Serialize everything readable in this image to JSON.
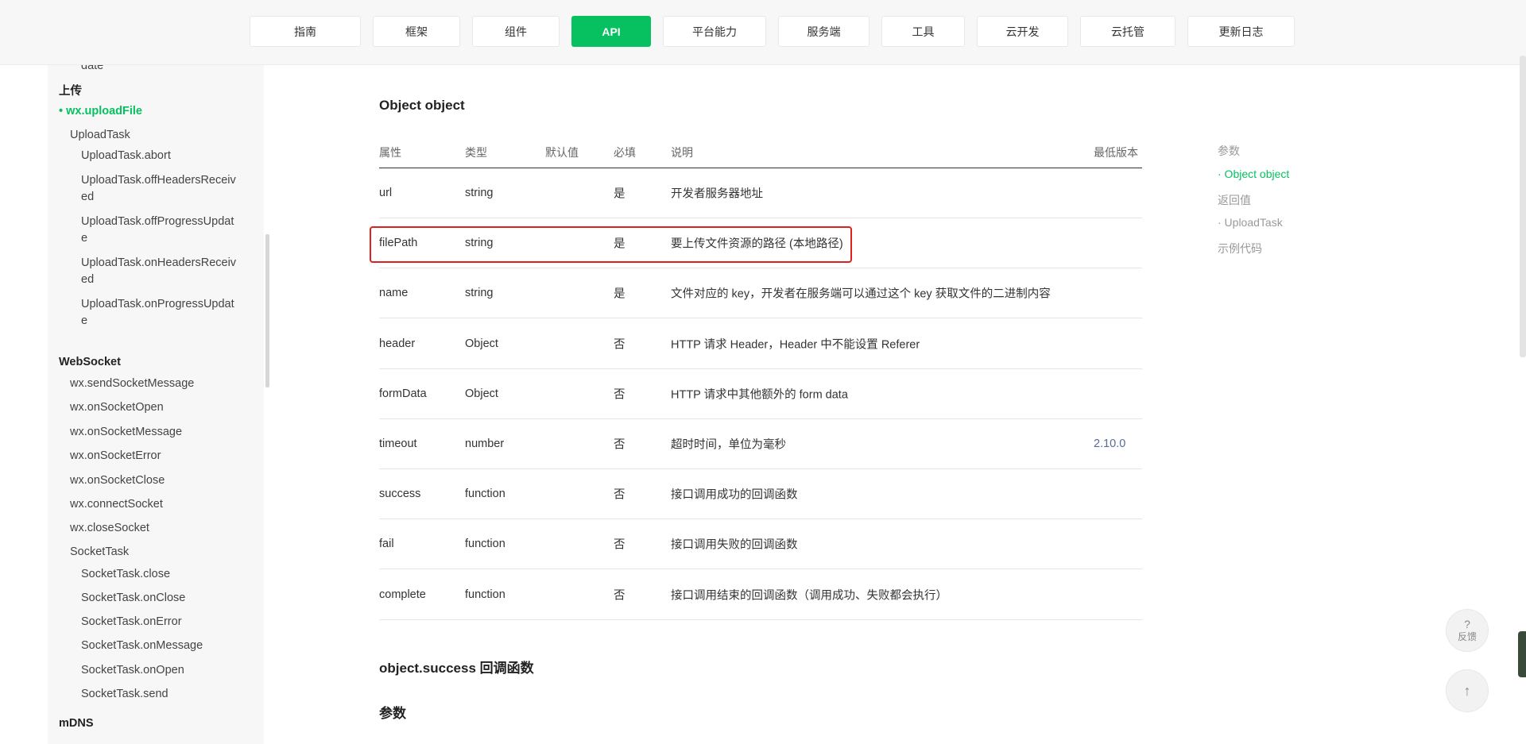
{
  "top_nav": {
    "tabs": [
      {
        "label": "指南",
        "active": false
      },
      {
        "label": "框架",
        "active": false
      },
      {
        "label": "组件",
        "active": false
      },
      {
        "label": "API",
        "active": true
      },
      {
        "label": "平台能力",
        "active": false
      },
      {
        "label": "服务端",
        "active": false
      },
      {
        "label": "工具",
        "active": false
      },
      {
        "label": "云开发",
        "active": false
      },
      {
        "label": "云托管",
        "active": false
      },
      {
        "label": "更新日志",
        "active": false
      }
    ]
  },
  "sidebar": {
    "items": [
      {
        "label": "date",
        "kind": "sub"
      },
      {
        "label": "上传",
        "kind": "group"
      },
      {
        "label": "• wx.uploadFile",
        "kind": "active"
      },
      {
        "label": "UploadTask",
        "kind": "item"
      },
      {
        "label": "UploadTask.abort",
        "kind": "sub"
      },
      {
        "label": "UploadTask.offHeadersReceiv",
        "kind": "sub"
      },
      {
        "label": "ed",
        "kind": "sub"
      },
      {
        "label": "UploadTask.offProgressUpdat",
        "kind": "sub"
      },
      {
        "label": "e",
        "kind": "sub"
      },
      {
        "label": "UploadTask.onHeadersReceiv",
        "kind": "sub"
      },
      {
        "label": "ed",
        "kind": "sub"
      },
      {
        "label": "UploadTask.onProgressUpdat",
        "kind": "sub"
      },
      {
        "label": "e",
        "kind": "sub"
      },
      {
        "label": "WebSocket",
        "kind": "group"
      },
      {
        "label": "wx.sendSocketMessage",
        "kind": "item"
      },
      {
        "label": "wx.onSocketOpen",
        "kind": "item"
      },
      {
        "label": "wx.onSocketMessage",
        "kind": "item"
      },
      {
        "label": "wx.onSocketError",
        "kind": "item"
      },
      {
        "label": "wx.onSocketClose",
        "kind": "item"
      },
      {
        "label": "wx.connectSocket",
        "kind": "item"
      },
      {
        "label": "wx.closeSocket",
        "kind": "item"
      },
      {
        "label": "SocketTask",
        "kind": "item"
      },
      {
        "label": "SocketTask.close",
        "kind": "sub"
      },
      {
        "label": "SocketTask.onClose",
        "kind": "sub"
      },
      {
        "label": "SocketTask.onError",
        "kind": "sub"
      },
      {
        "label": "SocketTask.onMessage",
        "kind": "sub"
      },
      {
        "label": "SocketTask.onOpen",
        "kind": "sub"
      },
      {
        "label": "SocketTask.send",
        "kind": "sub"
      },
      {
        "label": "mDNS",
        "kind": "group"
      }
    ]
  },
  "main": {
    "section_title": "Object object",
    "table": {
      "headers": [
        "属性",
        "类型",
        "默认值",
        "必填",
        "说明",
        "最低版本"
      ],
      "rows": [
        {
          "name": "url",
          "type": "string",
          "default": "",
          "required": "是",
          "desc": "开发者服务器地址",
          "version": ""
        },
        {
          "name": "filePath",
          "type": "string",
          "default": "",
          "required": "是",
          "desc": "要上传文件资源的路径 (本地路径)",
          "version": ""
        },
        {
          "name": "name",
          "type": "string",
          "default": "",
          "required": "是",
          "desc": "文件对应的 key，开发者在服务端可以通过这个 key 获取文件的二进制内容",
          "version": ""
        },
        {
          "name": "header",
          "type": "Object",
          "default": "",
          "required": "否",
          "desc": "HTTP 请求 Header，Header 中不能设置 Referer",
          "version": ""
        },
        {
          "name": "formData",
          "type": "Object",
          "default": "",
          "required": "否",
          "desc": "HTTP 请求中其他额外的 form data",
          "version": ""
        },
        {
          "name": "timeout",
          "type": "number",
          "default": "",
          "required": "否",
          "desc": "超时时间，单位为毫秒",
          "version": "2.10.0"
        },
        {
          "name": "success",
          "type": "function",
          "default": "",
          "required": "否",
          "desc": "接口调用成功的回调函数",
          "version": ""
        },
        {
          "name": "fail",
          "type": "function",
          "default": "",
          "required": "否",
          "desc": "接口调用失败的回调函数",
          "version": ""
        },
        {
          "name": "complete",
          "type": "function",
          "default": "",
          "required": "否",
          "desc": "接口调用结束的回调函数（调用成功、失败都会执行）",
          "version": ""
        }
      ]
    },
    "success_title": "object.success 回调函数",
    "params_title": "参数"
  },
  "toc": {
    "items": [
      {
        "label": "参数",
        "current": false
      },
      {
        "label": "· Object object",
        "current": true
      },
      {
        "label": "返回值",
        "current": false
      },
      {
        "label": "· UploadTask",
        "current": false
      },
      {
        "label": "示例代码",
        "current": false
      }
    ]
  },
  "fabs": {
    "feedback_icon": "?",
    "feedback_label": "反馈",
    "top_icon": "↑"
  },
  "colors": {
    "accent": "#07c160",
    "highlight": "#e02020",
    "link": "#576b95"
  }
}
